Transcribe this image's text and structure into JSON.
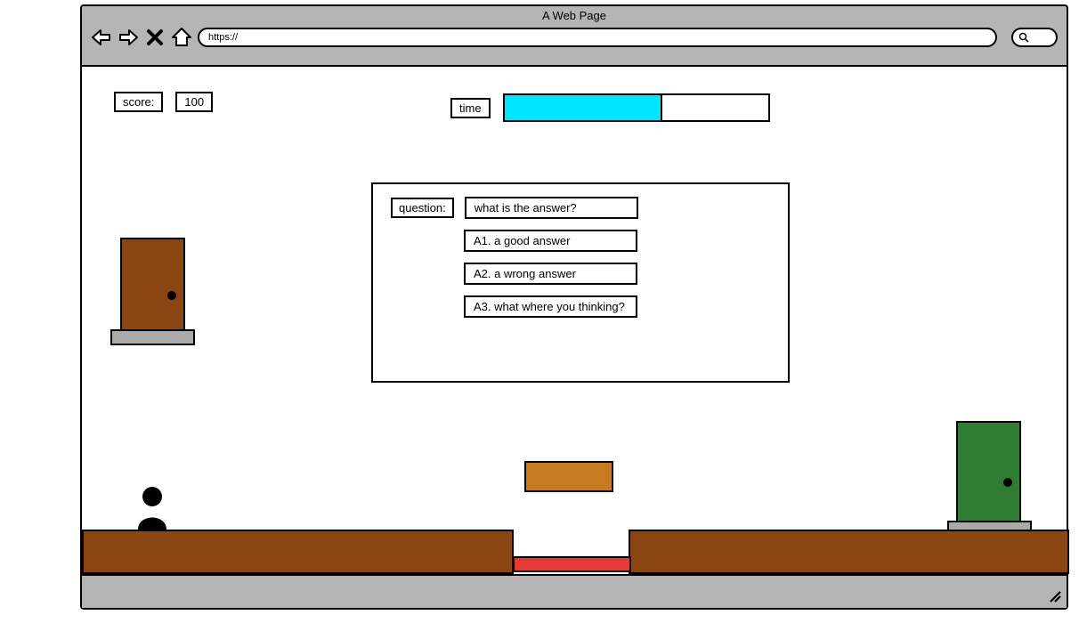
{
  "browser": {
    "title": "A Web Page",
    "url": "https://"
  },
  "hud": {
    "score_label": "score:",
    "score_value": "100",
    "time_label": "time"
  },
  "question": {
    "label": "question:",
    "text": "what is the answer?",
    "answers": [
      "A1. a good answer",
      "A2. a wrong answer",
      "A3. what where you thinking?"
    ]
  },
  "colors": {
    "time_fill": "#00e5ff",
    "door_brown": "#8b4513",
    "door_green": "#2e7d32",
    "crate": "#c87a1e",
    "hazard": "#e53935",
    "chrome": "#b5b5b5"
  }
}
